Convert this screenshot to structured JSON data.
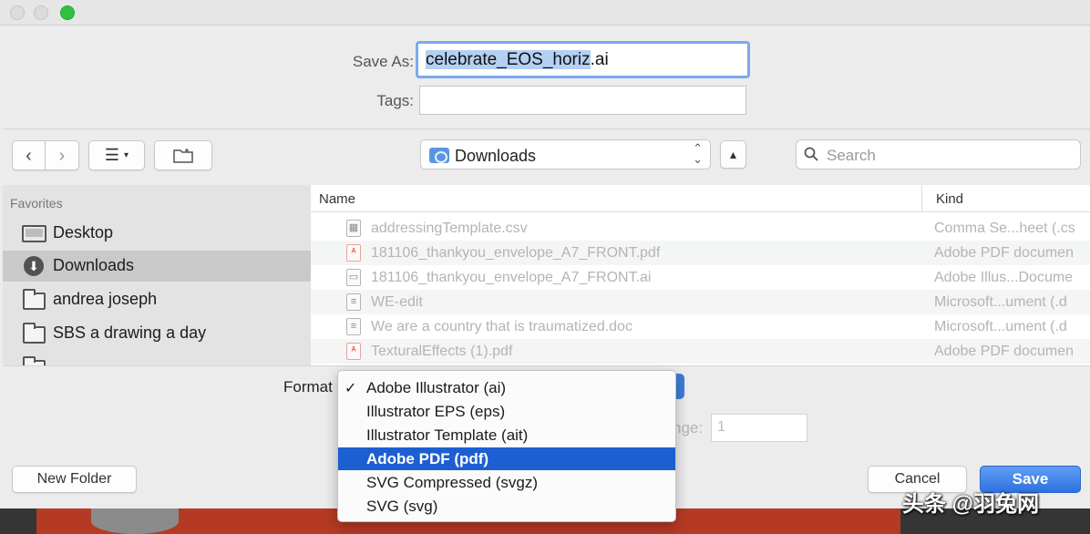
{
  "save_as": {
    "label": "Save As:",
    "filename_selected": "celebrate_EOS_horiz",
    "filename_ext": ".ai"
  },
  "tags": {
    "label": "Tags:",
    "value": ""
  },
  "toolbar": {
    "location": "Downloads",
    "search_placeholder": "Search"
  },
  "sidebar": {
    "heading": "Favorites",
    "items": [
      {
        "label": "Desktop",
        "icon": "desktop-icon",
        "active": false
      },
      {
        "label": "Downloads",
        "icon": "downloads-icon",
        "active": true
      },
      {
        "label": "andrea joseph",
        "icon": "folder-icon",
        "active": false
      },
      {
        "label": "SBS a drawing a day",
        "icon": "folder-icon",
        "active": false
      },
      {
        "label": "",
        "icon": "folder-icon",
        "active": false
      }
    ]
  },
  "file_list": {
    "columns": [
      "Name",
      "Kind"
    ],
    "rows": [
      {
        "name": "addressingTemplate.csv",
        "kind": "Comma Se...heet (.cs",
        "icon": "spreadsheet-icon"
      },
      {
        "name": "181106_thankyou_envelope_A7_FRONT.pdf",
        "kind": "Adobe PDF documen",
        "icon": "pdf-icon"
      },
      {
        "name": "181106_thankyou_envelope_A7_FRONT.ai",
        "kind": "Adobe Illus...Docume",
        "icon": "illustrator-file-icon"
      },
      {
        "name": "WE-edit",
        "kind": "Microsoft...ument (.d",
        "icon": "word-doc-icon"
      },
      {
        "name": "We are a country that is traumatized.doc",
        "kind": "Microsoft...ument (.d",
        "icon": "word-doc-icon"
      },
      {
        "name": "TexturalEffects (1).pdf",
        "kind": "Adobe PDF documen",
        "icon": "pdf-icon"
      }
    ]
  },
  "format": {
    "label": "Format",
    "options": [
      {
        "label": "Adobe Illustrator (ai)",
        "checked": true,
        "highlighted": false
      },
      {
        "label": "Illustrator EPS (eps)",
        "checked": false,
        "highlighted": false
      },
      {
        "label": "Illustrator Template (ait)",
        "checked": false,
        "highlighted": false
      },
      {
        "label": "Adobe PDF (pdf)",
        "checked": false,
        "highlighted": true
      },
      {
        "label": "SVG Compressed (svgz)",
        "checked": false,
        "highlighted": false
      },
      {
        "label": "SVG (svg)",
        "checked": false,
        "highlighted": false
      }
    ]
  },
  "range": {
    "label": "nge:",
    "value": "1"
  },
  "buttons": {
    "new_folder": "New Folder",
    "cancel": "Cancel",
    "save": "Save"
  },
  "watermark": "头条 @羽兔网",
  "colors": {
    "accent": "#1d5fd1",
    "save_button": "#3b7ddb",
    "selection": "#b5d0f3"
  }
}
